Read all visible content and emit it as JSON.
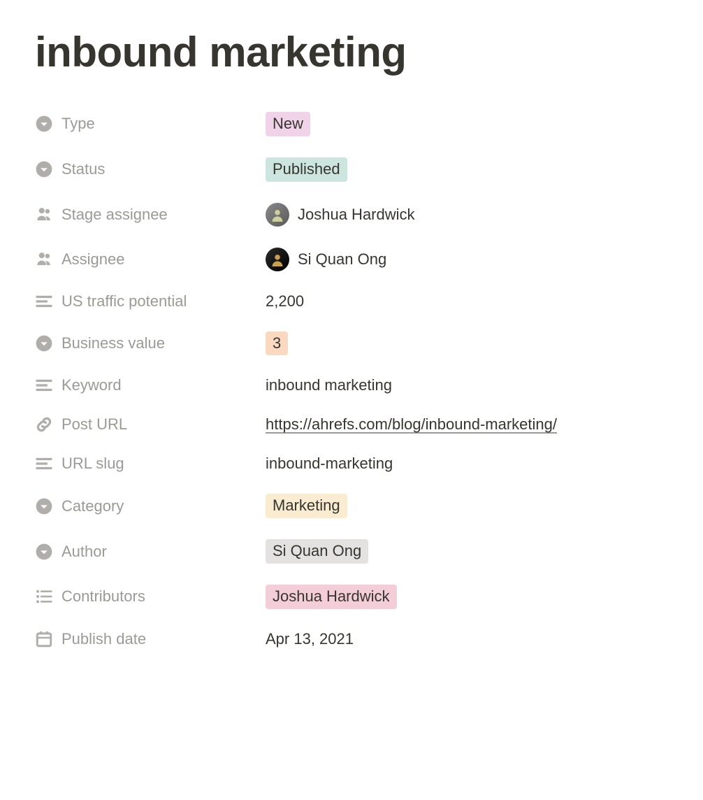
{
  "title": "inbound marketing",
  "properties": {
    "type": {
      "label": "Type",
      "value": "New"
    },
    "status": {
      "label": "Status",
      "value": "Published"
    },
    "stage_assignee": {
      "label": "Stage assignee",
      "value": "Joshua Hardwick"
    },
    "assignee": {
      "label": "Assignee",
      "value": "Si Quan Ong"
    },
    "us_traffic_potential": {
      "label": "US traffic potential",
      "value": "2,200"
    },
    "business_value": {
      "label": "Business value",
      "value": "3"
    },
    "keyword": {
      "label": "Keyword",
      "value": "inbound marketing"
    },
    "post_url": {
      "label": "Post URL",
      "value": "https://ahrefs.com/blog/inbound-marketing/"
    },
    "url_slug": {
      "label": "URL slug",
      "value": "inbound-marketing"
    },
    "category": {
      "label": "Category",
      "value": "Marketing"
    },
    "author": {
      "label": "Author",
      "value": "Si Quan Ong"
    },
    "contributors": {
      "label": "Contributors",
      "value": "Joshua Hardwick"
    },
    "publish_date": {
      "label": "Publish date",
      "value": "Apr 13, 2021"
    }
  }
}
